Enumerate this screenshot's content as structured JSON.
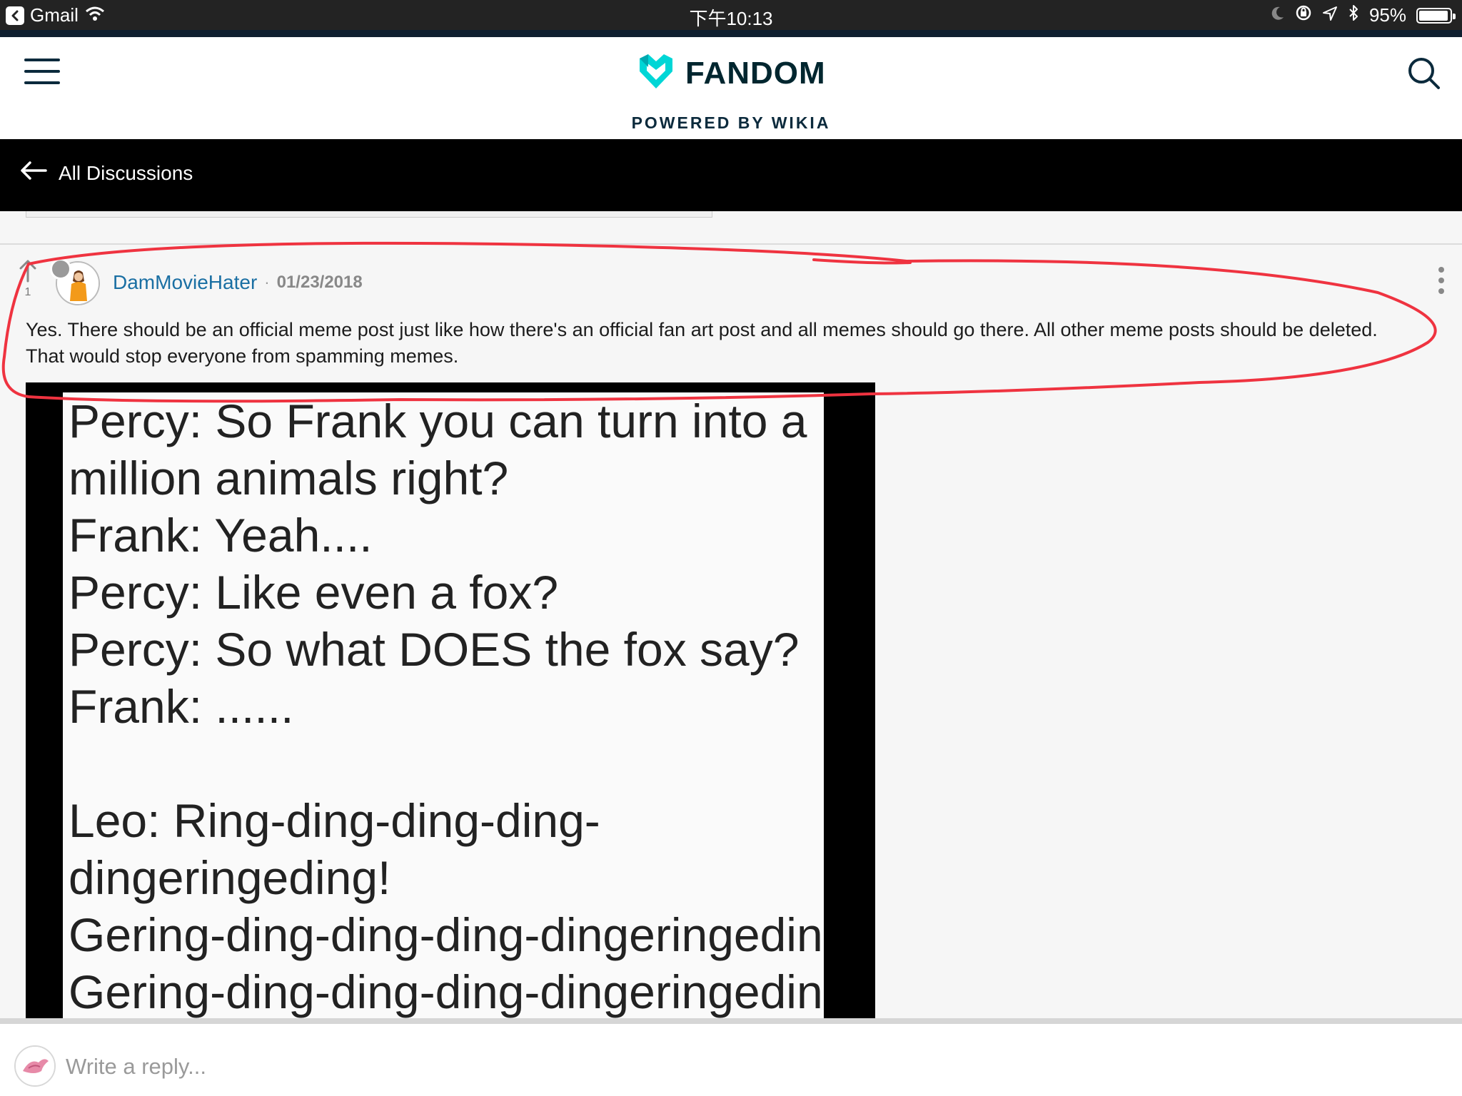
{
  "status_bar": {
    "back_app": "Gmail",
    "time": "下午10:13",
    "battery": "95%",
    "battery_level": 0.95
  },
  "header": {
    "logo_text": "FANDOM",
    "powered_by": "POWERED BY WIKIA"
  },
  "nav": {
    "back_label": "All Discussions"
  },
  "post": {
    "upvotes": "1",
    "username": "DamMovieHater",
    "separator": "·",
    "date": "01/23/2018",
    "body": "Yes. There should be an official meme post just like how there's an official fan art post and all memes should go there. All other meme posts should be deleted. That would stop everyone from spamming memes."
  },
  "meme": {
    "lines": [
      "Percy: So Frank you can turn into a",
      "million animals right?",
      "Frank: Yeah....",
      "Percy: Like even a fox?",
      "Percy: So what DOES the fox say?",
      "Frank: ......",
      "Leo: Ring-ding-ding-ding-",
      "dingeringeding!",
      "Gering-ding-ding-ding-dingeringeding",
      "Gering-ding-ding-ding-dingeringeding"
    ]
  },
  "reply": {
    "placeholder": "Write a reply..."
  },
  "colors": {
    "brand_teal": "#00d6d6",
    "annotation_red": "#ef3340",
    "username_blue": "#1a6fa3"
  },
  "icons": [
    "wifi-icon",
    "moon-icon",
    "rotation-lock-icon",
    "location-icon",
    "bluetooth-icon",
    "hamburger-icon",
    "fandom-heart-icon",
    "search-icon",
    "arrow-left-icon",
    "upvote-arrow-icon",
    "more-vert-icon"
  ]
}
